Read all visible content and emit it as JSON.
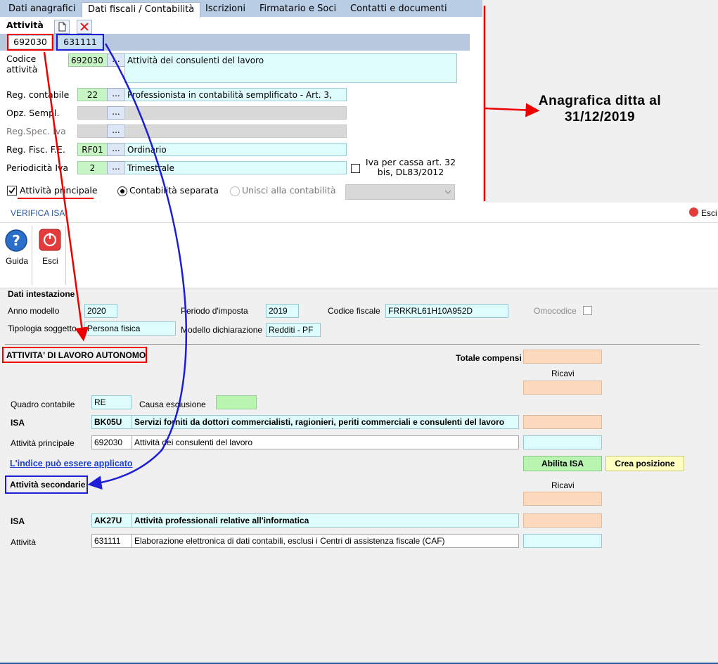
{
  "tabs": [
    "Dati anagrafici",
    "Dati fiscali / Contabilità",
    "Iscrizioni",
    "Firmatario e Soci",
    "Contatti e documenti"
  ],
  "top": {
    "section_title": "Attività",
    "codes": [
      "692030",
      "631111"
    ],
    "codice_label": "Codice attività",
    "codice_value": "692030",
    "codice_desc": "Attività dei consulenti del lavoro",
    "reg_contabile_label": "Reg. contabile",
    "reg_contabile_code": "22",
    "reg_contabile_desc": "Professionista in contabilità semplificato - Art. 3,",
    "opz_sempl_label": "Opz. Sempl.",
    "reg_spec_iva_label": "Reg.Spec. Iva",
    "reg_fisc_label": "Reg. Fisc. F.E.",
    "reg_fisc_code": "RF01",
    "reg_fisc_desc": "Ordinario",
    "periodicita_label": "Periodicità Iva",
    "periodicita_code": "2",
    "periodicita_desc": "Trimestrale",
    "iva_cassa_label": "Iva per cassa art. 32 bis, DL83/2012",
    "attivita_principale_label": "Attività principale",
    "contabilita_separata_label": "Contabilità separata",
    "unisci_label": "Unisci alla contabilità",
    "dots": "..."
  },
  "annotation": "Anagrafica ditta al 31/12/2019",
  "isa": {
    "window_title": "VERIFICA ISA",
    "exit_label": "Esci",
    "guida_label": "Guida",
    "esci_label": "Esci",
    "intestazione_title": "Dati intestazione",
    "anno_modello_label": "Anno modello",
    "anno_modello_value": "2020",
    "periodo_label": "Periodo d'imposta",
    "periodo_value": "2019",
    "codice_fiscale_label": "Codice fiscale",
    "codice_fiscale_value": "FRRKRL61H10A952D",
    "omocodice_label": "Omocodice",
    "tipologia_label": "Tipologia soggetto",
    "tipologia_value": "Persona fisica",
    "modello_label": "Modello dichiarazione",
    "modello_value": "Redditi - PF",
    "lavoro_autonomo_title": "ATTIVITA' DI LAVORO AUTONOMO",
    "totale_compensi_label": "Totale compensi",
    "ricavi_label": "Ricavi",
    "quadro_label": "Quadro contabile",
    "quadro_value": "RE",
    "causa_label": "Causa esclusione",
    "isa_label": "ISA",
    "isa1_code": "BK05U",
    "isa1_desc": "Servizi forniti da dottori commercialisti, ragionieri, periti commerciali e consulenti del lavoro",
    "att_principale_label": "Attività principale",
    "att_principale_code": "692030",
    "att_principale_desc": "Attività dei consulenti del lavoro",
    "indice_link": "L'indice può essere applicato",
    "abilita_btn": "Abilita ISA",
    "crea_btn": "Crea posizione",
    "secondarie_title": "Attività secondarie",
    "ricavi2_label": "Ricavi",
    "isa2_label": "ISA",
    "isa2_code": "AK27U",
    "isa2_desc": "Attività professionali relative all'informatica",
    "attivita_label": "Attività",
    "attivita_code": "631111",
    "attivita_desc": "Elaborazione elettronica di dati contabili, esclusi i Centri di assistenza fiscale (CAF)"
  }
}
